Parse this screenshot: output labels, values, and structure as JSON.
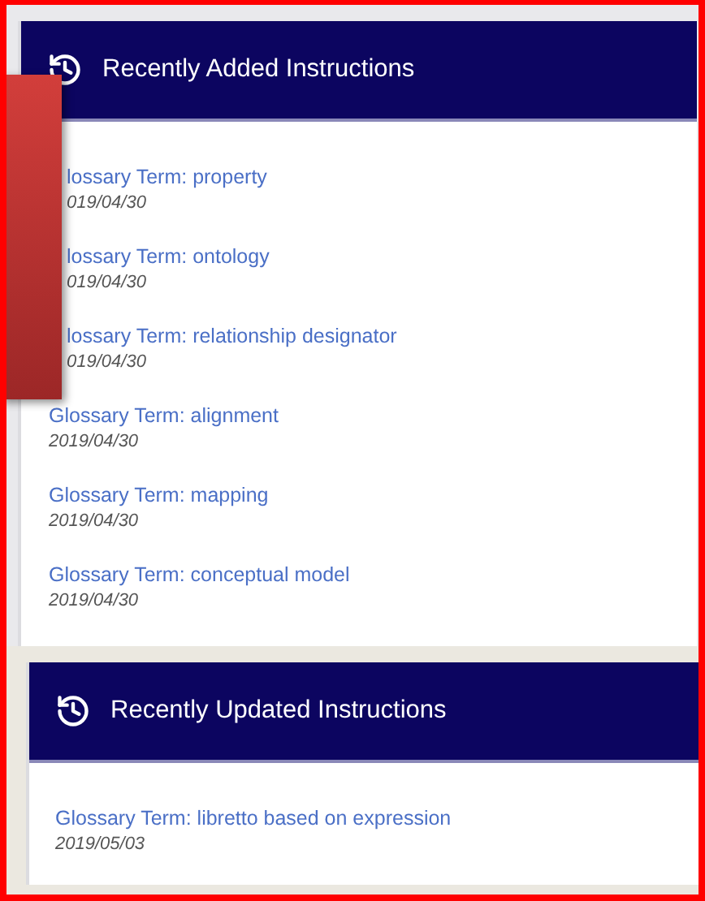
{
  "panels": [
    {
      "title": "Recently Added Instructions",
      "items": [
        {
          "title": "lossary Term: property",
          "date": "019/04/30",
          "covered": true
        },
        {
          "title": "lossary Term: ontology",
          "date": "019/04/30",
          "covered": true
        },
        {
          "title": "lossary Term: relationship designator",
          "date": "019/04/30",
          "covered": true
        },
        {
          "title": "Glossary Term: alignment",
          "date": "2019/04/30",
          "covered": false
        },
        {
          "title": "Glossary Term: mapping",
          "date": "2019/04/30",
          "covered": false
        },
        {
          "title": "Glossary Term: conceptual model",
          "date": "2019/04/30",
          "covered": false
        }
      ]
    },
    {
      "title": "Recently Updated Instructions",
      "items": [
        {
          "title": "Glossary Term: libretto based on expression",
          "date": "2019/05/03",
          "covered": false
        }
      ]
    }
  ]
}
